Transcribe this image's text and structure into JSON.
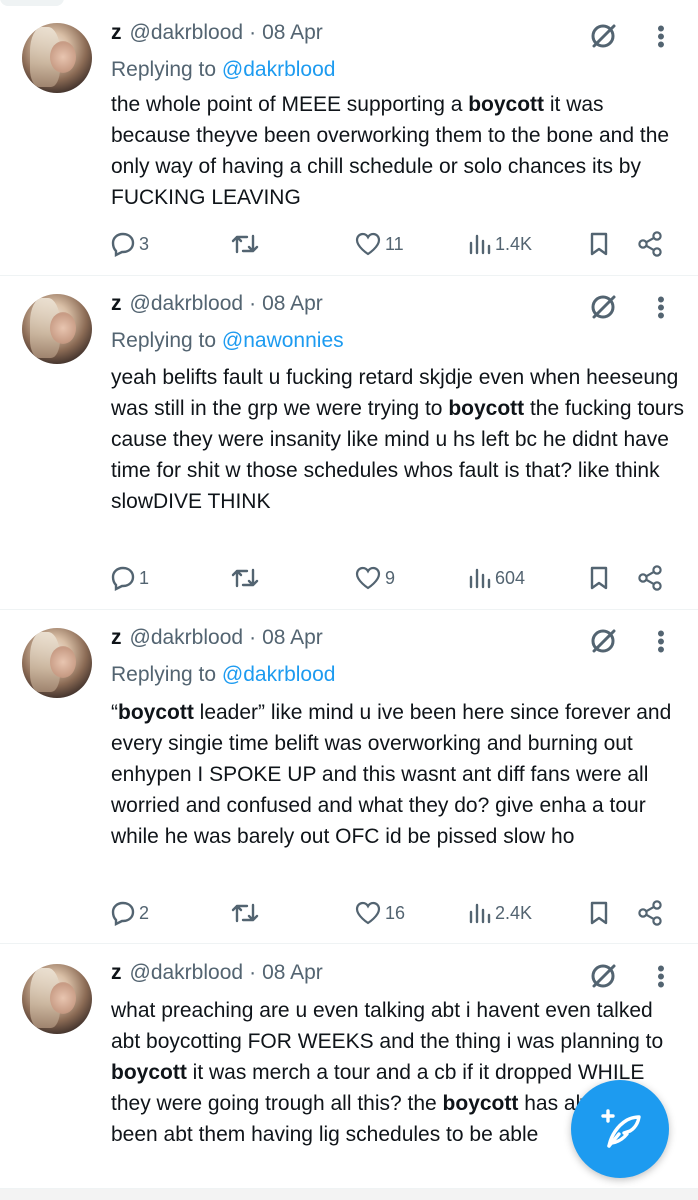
{
  "tweets": [
    {
      "name": "z",
      "handle": "@dakrblood",
      "separator": "·",
      "date": "08 Apr",
      "replying_prefix": "Replying to ",
      "replying_to": "@dakrblood",
      "text": [
        "the whole point of MEEE supporting a ",
        "boycott",
        " it was because theyve been overworking them to the bone and the only way of having a chill schedule or solo chances its by FUCKING LEAVING"
      ],
      "replies": "3",
      "retweets": "",
      "likes": "11",
      "views": "1.4K"
    },
    {
      "name": "z",
      "handle": "@dakrblood",
      "separator": "·",
      "date": "08 Apr",
      "replying_prefix": "Replying to ",
      "replying_to": "@nawonnies",
      "text": [
        "yeah belifts fault u fucking retard skjdje even when heeseung was still in the grp we were trying to ",
        "boycott",
        " the fucking tours cause they were insanity like mind u hs left bc he didnt have time for shit w those schedules whos fault is that? like think slowDIVE THINK"
      ],
      "replies": "1",
      "retweets": "",
      "likes": "9",
      "views": "604"
    },
    {
      "name": "z",
      "handle": "@dakrblood",
      "separator": "·",
      "date": "08 Apr",
      "replying_prefix": "Replying to ",
      "replying_to": "@dakrblood",
      "text": [
        "“",
        "boycott",
        " leader” like mind u ive been here since forever and every singie time belift was overworking and burning out enhypen I SPOKE UP and this wasnt ant diff fans were all worried and confused and what they do? give enha a tour while he was barely out OFC id be pissed slow ho"
      ],
      "replies": "2",
      "retweets": "",
      "likes": "16",
      "views": "2.4K"
    },
    {
      "name": "z",
      "handle": "@dakrblood",
      "separator": "·",
      "date": "08 Apr",
      "text": [
        "what preaching are u even talking abt i havent even talked abt boycotting FOR WEEKS and the thing i was planning to ",
        "boycott",
        " it was merch a tour and a cb if it dropped WHILE they were going trough all this? the ",
        "boycott",
        " has always been abt them having lig",
        "",
        " schedules to be able"
      ]
    }
  ],
  "icons": {
    "reply": "reply-icon",
    "retweet": "retweet-icon",
    "like": "heart-icon",
    "views": "views-icon",
    "bookmark": "bookmark-icon",
    "share": "share-icon",
    "grok": "grok-icon",
    "more": "more-icon",
    "compose": "compose-icon"
  },
  "colors": {
    "accent": "#1d9bf0",
    "muted": "#536471",
    "text": "#0f1419"
  }
}
